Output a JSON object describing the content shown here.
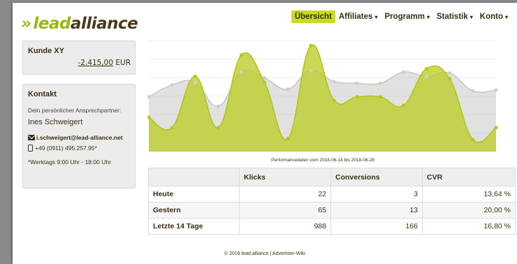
{
  "brand": {
    "prefix": "»",
    "lead": "lead",
    "alliance": "alliance"
  },
  "nav": [
    {
      "label": "Übersicht",
      "active": true,
      "caret": false
    },
    {
      "label": "Affiliates",
      "active": false,
      "caret": true
    },
    {
      "label": "Programm",
      "active": false,
      "caret": true
    },
    {
      "label": "Statistik",
      "active": false,
      "caret": true
    },
    {
      "label": "Konto",
      "active": false,
      "caret": true
    }
  ],
  "customer": {
    "title": "Kunde XY",
    "balance": "-2.415,00",
    "currency": "EUR"
  },
  "contact": {
    "title": "Kontakt",
    "subtitle": "Dein persönlicher Ansprechpartner:",
    "name": "Ines Schweigert",
    "email": "i.schweigert@lead-alliance.net",
    "phone": "+49 (0911) 495.257.95*",
    "hours": "*Werktags 9:00 Uhr - 18:00 Uhr"
  },
  "chart_data": {
    "type": "area",
    "title": "Performancedaten vom 2018-06-14 bis 2018-06-28",
    "xlabel": "",
    "ylabel": "",
    "series": [
      {
        "color": "#d0d0d0",
        "values": [
          64,
          78,
          81,
          53,
          93,
          86,
          73,
          95,
          82,
          80,
          80,
          93,
          88,
          92,
          71,
          72
        ]
      },
      {
        "color": "#bccd25",
        "values": [
          40,
          28,
          88,
          28,
          113,
          81,
          15,
          124,
          60,
          64,
          64,
          54,
          97,
          85,
          14,
          28
        ]
      }
    ],
    "y_note": "values read as relative heights, no axis printed",
    "grid": true
  },
  "stats": {
    "headers": [
      "",
      "Klicks",
      "Conversions",
      "CVR"
    ],
    "rows": [
      {
        "label": "Heute",
        "klicks": "22",
        "conversions": "3",
        "cvr": "13,64 %"
      },
      {
        "label": "Gestern",
        "klicks": "65",
        "conversions": "13",
        "cvr": "20,00 %"
      },
      {
        "label": "Letzte 14 Tage",
        "klicks": "988",
        "conversions": "166",
        "cvr": "16,80 %"
      }
    ]
  },
  "footer": "© 2018 lead alliance | Advertiser-Wiki",
  "icons": {
    "mail": "envelope-icon",
    "phone": "phone-icon"
  },
  "colors": {
    "accent": "#c8dc20",
    "brand_green": "#9ab613",
    "brand_dark": "#4a3a1c"
  }
}
